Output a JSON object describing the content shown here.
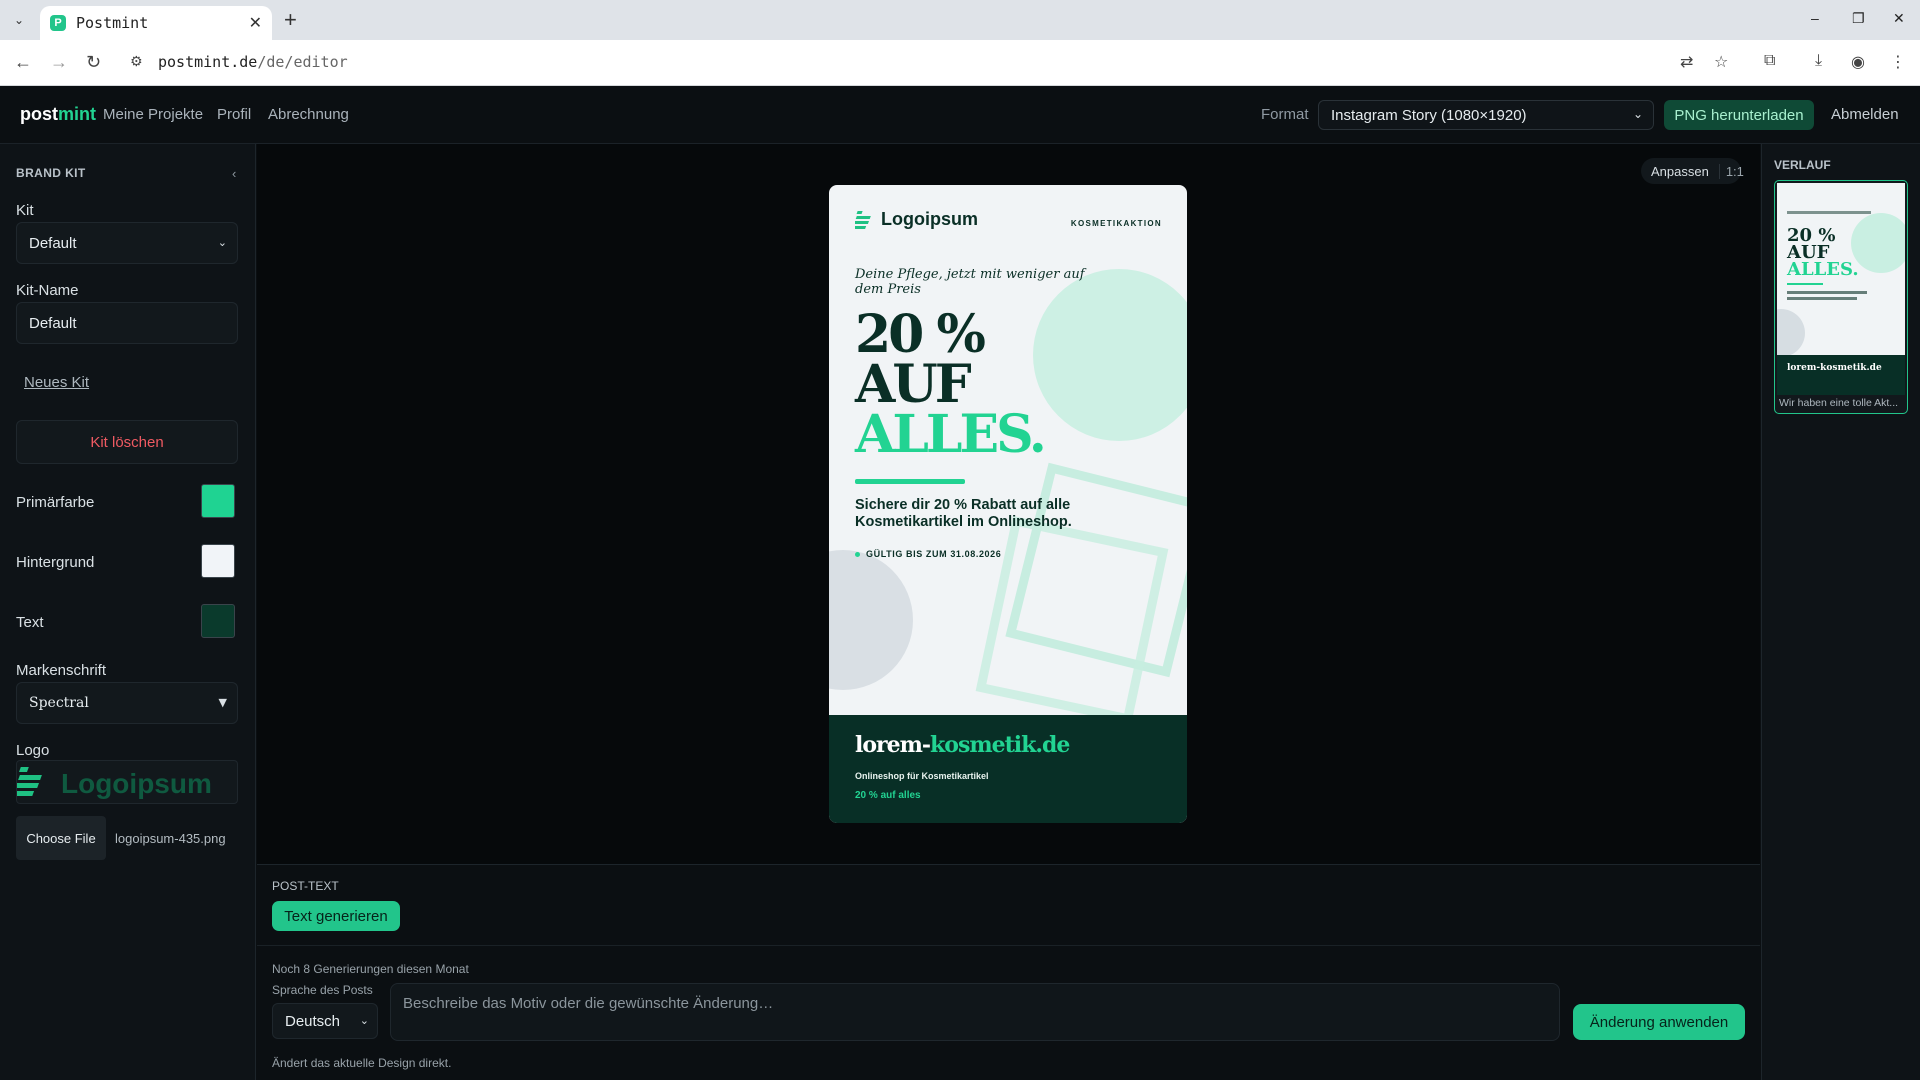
{
  "browser": {
    "tab_title": "Postmint",
    "favicon_letter": "P",
    "url_host": "postmint.de",
    "url_path": "/de/editor"
  },
  "header": {
    "brand_a": "post",
    "brand_b": "mint",
    "nav": [
      "Meine Projekte",
      "Profil",
      "Abrechnung"
    ],
    "format_label": "Format",
    "format_value": "Instagram Story (1080×1920)",
    "download_label": "PNG herunterladen",
    "logout_label": "Abmelden"
  },
  "sidebar": {
    "title": "BRAND KIT",
    "kit_label": "Kit",
    "kit_value": "Default",
    "kit_name_label": "Kit-Name",
    "kit_name_value": "Default",
    "new_kit_label": "Neues Kit",
    "delete_label": "Kit löschen",
    "primary_label": "Primärfarbe",
    "background_label": "Hintergrund",
    "text_label": "Text",
    "font_label": "Markenschrift",
    "font_value": "Spectral",
    "logo_label": "Logo",
    "file_button": "Choose File",
    "file_name": "logoipsum-435.png",
    "colors": {
      "primary": "#1fd392",
      "background": "#f1f4f8",
      "text": "#0a3a2c"
    }
  },
  "canvas": {
    "fit_label": "Anpassen",
    "ratio_label": "1:1"
  },
  "poster": {
    "logo_name": "Logoipsum",
    "tag": "KOSMETIKAKTION",
    "subtitle": "Deine Pflege, jetzt mit weniger auf dem Preis",
    "headline_1": "20 %",
    "headline_2": "AUF",
    "headline_3": "ALLES.",
    "body": "Sichere dir 20 % Rabatt auf alle Kosmetikartikel im Onlineshop.",
    "validity": "GÜLTIG BIS ZUM 31.08.2026",
    "domain_a": "lorem-",
    "domain_b": "kosmetik.de",
    "shop_line": "Onlineshop für Kosmetikartikel",
    "offer_line": "20 % auf alles"
  },
  "post_text": {
    "title": "POST-TEXT",
    "generate_label": "Text generieren",
    "quota": "Noch 8 Generierungen diesen Monat",
    "language_label": "Sprache des Posts",
    "language_value": "Deutsch",
    "prompt_placeholder": "Beschreibe das Motiv oder die gewünschte Änderung…",
    "apply_label": "Änderung anwenden",
    "hint": "Ändert das aktuelle Design direkt."
  },
  "history": {
    "title": "VERLAUF",
    "items": [
      {
        "caption": "Wir haben eine tolle Akt...",
        "thumb_head_1": "20 %",
        "thumb_head_2": "AUF",
        "thumb_head_3": "ALLES.",
        "thumb_domain": "lorem-kosmetik.de"
      }
    ]
  }
}
